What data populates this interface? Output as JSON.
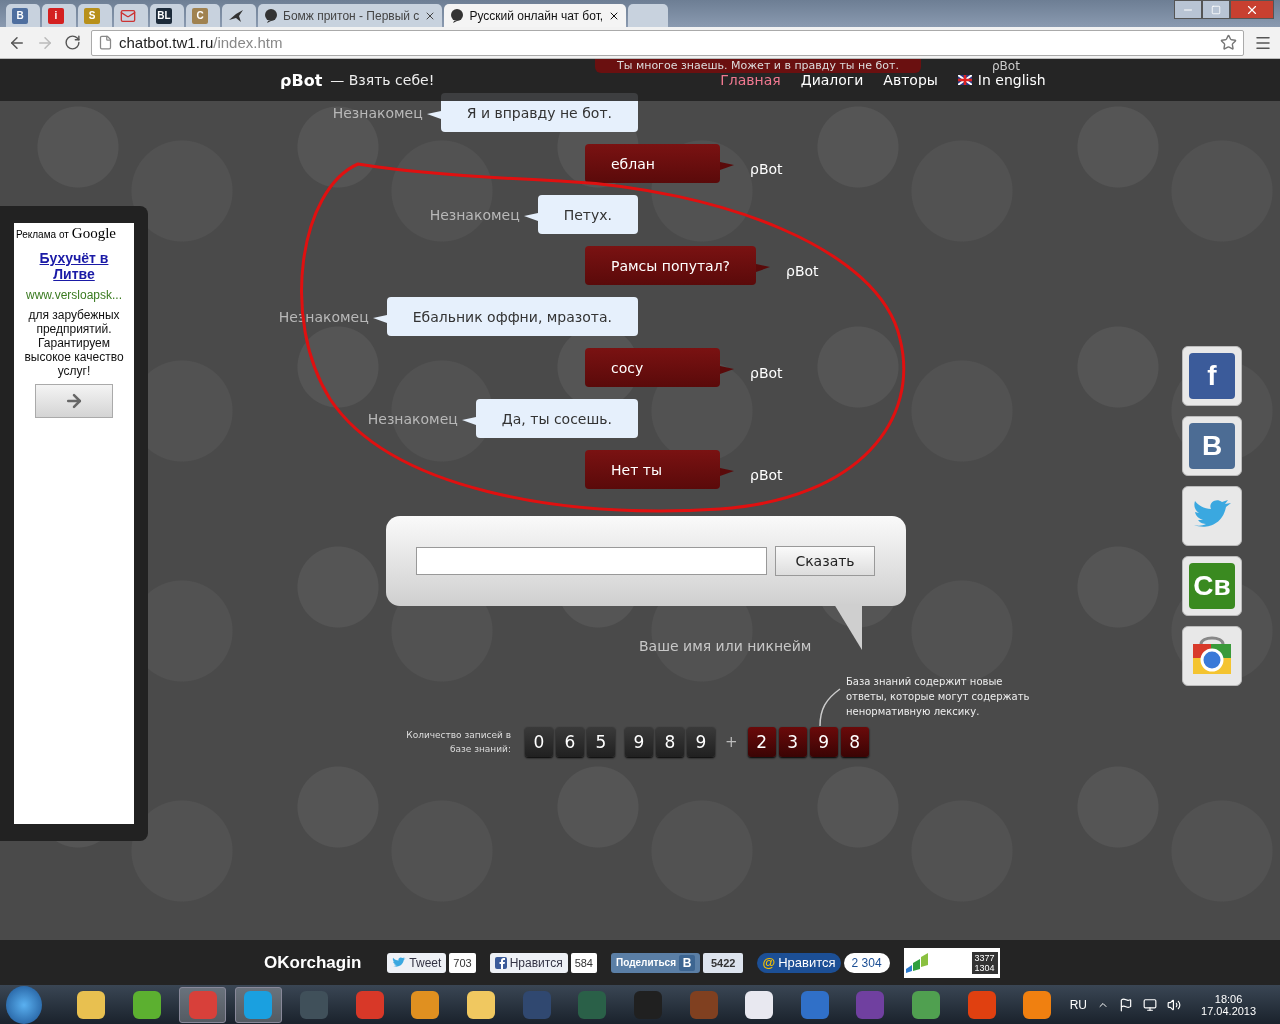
{
  "browser": {
    "tabs": [
      {
        "kind": "pinned",
        "glyph": "В",
        "color": "#4f6f9f",
        "selected": false
      },
      {
        "kind": "pinned",
        "glyph": "i",
        "color": "#d42020",
        "selected": false
      },
      {
        "kind": "pinned",
        "glyph": "S",
        "color": "#b8901a",
        "selected": false
      },
      {
        "kind": "mail",
        "selected": false
      },
      {
        "kind": "pinned",
        "glyph": "BL",
        "color": "#1d2b3a",
        "selected": false
      },
      {
        "kind": "pinned",
        "glyph": "C",
        "color": "#a08250",
        "selected": false
      },
      {
        "kind": "bird",
        "selected": false
      },
      {
        "kind": "page",
        "title": "Бомж притон - Первый с",
        "selected": false
      },
      {
        "kind": "page",
        "title": "Русский онлайн чат бот,",
        "selected": true
      }
    ],
    "address": {
      "host": "chatbot.tw1.ru",
      "path": "/index.htm"
    }
  },
  "header": {
    "logo": "ρBot",
    "tagline": "— Взять себе!",
    "nav": [
      {
        "kind": "link",
        "label": "Главная",
        "selected": true
      },
      {
        "kind": "link",
        "label": "Диалоги",
        "selected": false
      },
      {
        "kind": "link",
        "label": "Авторы",
        "selected": false
      },
      {
        "kind": "language",
        "label": "In english",
        "selected": false
      }
    ]
  },
  "cut_message": {
    "text": "Ты многое знаешь. Может и в правду ты не бот.",
    "sender": "ρBot"
  },
  "messages": [
    {
      "kind": "user",
      "sender": "Незнакомец",
      "text": "Я и вправду не бот."
    },
    {
      "kind": "bot",
      "sender": "ρBot",
      "text": "еблан"
    },
    {
      "kind": "user",
      "sender": "Незнакомец",
      "text": "Петух."
    },
    {
      "kind": "bot",
      "sender": "ρBot",
      "text": "Рамсы попутал?"
    },
    {
      "kind": "user",
      "sender": "Незнакомец",
      "text": "Ебальник оффни, мразота."
    },
    {
      "kind": "bot",
      "sender": "ρBot",
      "text": "сосу"
    },
    {
      "kind": "user",
      "sender": "Незнакомец",
      "text": "Да, ты сосешь."
    },
    {
      "kind": "bot",
      "sender": "ρBot",
      "text": "Нет ты"
    }
  ],
  "ad": {
    "label": "Реклама от",
    "brand": "Google",
    "title": "Бухучёт в Литве",
    "url": "www.versloapsk...",
    "body": "для зарубежных предприятий. Гарантируем высокое качество услуг!"
  },
  "chat_form": {
    "button": "Сказать",
    "name_hint": "Ваше имя или никнейм"
  },
  "counter": {
    "label": "Количество записей в базе знаний:",
    "groups": [
      [
        "0",
        "6",
        "5"
      ],
      [
        "9",
        "8",
        "9"
      ]
    ],
    "plus": "+",
    "new_digits": [
      "2",
      "3",
      "9",
      "8"
    ],
    "note": "База знаний содержит новые ответы, которые могут содержать ненормативную лексику."
  },
  "social": [
    {
      "kind": "facebook",
      "glyph": "f"
    },
    {
      "kind": "vk",
      "glyph": "В"
    },
    {
      "kind": "twitter"
    },
    {
      "kind": "cb",
      "glyph": "Св"
    },
    {
      "kind": "chrome"
    }
  ],
  "footer": {
    "author": "OKorchagin",
    "widgets": [
      {
        "kind": "tweet",
        "label": "Tweet",
        "count": "703"
      },
      {
        "kind": "fb",
        "label": "Нравится",
        "count": "584"
      },
      {
        "kind": "vk",
        "label": "Поделиться",
        "glyph": "В",
        "count": "5422"
      },
      {
        "kind": "mail",
        "glyph": "@",
        "label": "Нравится",
        "count": "2 304"
      }
    ],
    "stats": [
      "3377",
      "1304"
    ]
  },
  "taskbar": {
    "apps": [
      {
        "color": "#e8c050",
        "selected": false
      },
      {
        "color": "#5cb030",
        "selected": false
      },
      {
        "color": "#d8403a",
        "selected": true
      },
      {
        "color": "#1aa0e0",
        "selected": true
      },
      {
        "color": "#40505a",
        "selected": false
      },
      {
        "color": "#d83828",
        "selected": false
      },
      {
        "color": "#e09020",
        "selected": false
      },
      {
        "color": "#f0c860",
        "selected": false
      },
      {
        "color": "#304870",
        "selected": false
      },
      {
        "color": "#2a6048",
        "selected": false
      },
      {
        "color": "#202020",
        "selected": false
      },
      {
        "color": "#804020",
        "selected": false
      },
      {
        "color": "#e8e8f0",
        "selected": false
      },
      {
        "color": "#3070c8",
        "selected": false
      },
      {
        "color": "#7040a0",
        "selected": false
      },
      {
        "color": "#50a050",
        "selected": false
      },
      {
        "color": "#e04010",
        "selected": false
      },
      {
        "color": "#f08010",
        "selected": false
      }
    ],
    "language": "RU",
    "time": "18:06",
    "date": "17.04.2013"
  }
}
